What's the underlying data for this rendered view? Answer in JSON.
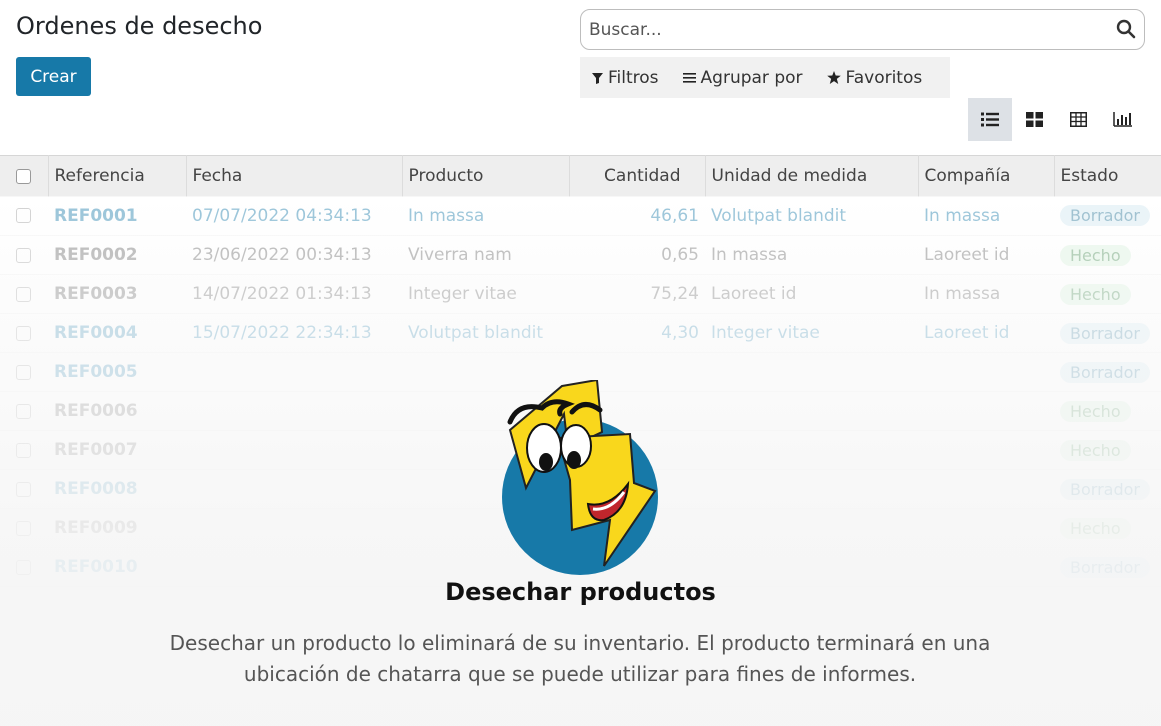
{
  "page": {
    "title": "Ordenes de desecho",
    "create_label": "Crear"
  },
  "search": {
    "placeholder": "Buscar...",
    "icon": "search-icon"
  },
  "filters": {
    "filters_label": "Filtros",
    "group_by_label": "Agrupar por",
    "favorites_label": "Favoritos"
  },
  "views": {
    "items": [
      "list-view-icon",
      "kanban-view-icon",
      "pivot-view-icon",
      "graph-view-icon"
    ],
    "active": "list-view-icon"
  },
  "table": {
    "headers": {
      "reference": "Referencia",
      "date": "Fecha",
      "product": "Producto",
      "quantity": "Cantidad",
      "uom": "Unidad de medida",
      "company": "Compañía",
      "state": "Estado"
    },
    "rows": [
      {
        "ref": "REF0001",
        "date": "07/07/2022 04:34:13",
        "product": "In massa",
        "qty": "46,61",
        "uom": "Volutpat blandit",
        "company": "In massa",
        "state": "Borrador",
        "state_kind": "draft",
        "link": true
      },
      {
        "ref": "REF0002",
        "date": "23/06/2022 00:34:13",
        "product": "Viverra nam",
        "qty": "0,65",
        "uom": "In massa",
        "company": "Laoreet id",
        "state": "Hecho",
        "state_kind": "done",
        "link": false
      },
      {
        "ref": "REF0003",
        "date": "14/07/2022 01:34:13",
        "product": "Integer vitae",
        "qty": "75,24",
        "uom": "Laoreet id",
        "company": "In massa",
        "state": "Hecho",
        "state_kind": "done",
        "link": false
      },
      {
        "ref": "REF0004",
        "date": "15/07/2022 22:34:13",
        "product": "Volutpat blandit",
        "qty": "4,30",
        "uom": "Integer vitae",
        "company": "Laoreet id",
        "state": "Borrador",
        "state_kind": "draft",
        "link": true
      },
      {
        "ref": "REF0005",
        "date": "",
        "product": "",
        "qty": "",
        "uom": "",
        "company": "",
        "state": "Borrador",
        "state_kind": "draft",
        "link": true
      },
      {
        "ref": "REF0006",
        "date": "",
        "product": "",
        "qty": "",
        "uom": "",
        "company": "",
        "state": "Hecho",
        "state_kind": "done",
        "link": false
      },
      {
        "ref": "REF0007",
        "date": "",
        "product": "",
        "qty": "",
        "uom": "",
        "company": "",
        "state": "Hecho",
        "state_kind": "done",
        "link": false
      },
      {
        "ref": "REF0008",
        "date": "",
        "product": "",
        "qty": "",
        "uom": "",
        "company": "",
        "state": "Borrador",
        "state_kind": "draft",
        "link": true
      },
      {
        "ref": "REF0009",
        "date": "",
        "product": "",
        "qty": "",
        "uom": "",
        "company": "",
        "state": "Hecho",
        "state_kind": "done",
        "link": false
      },
      {
        "ref": "REF0010",
        "date": "",
        "product": "",
        "qty": "",
        "uom": "",
        "company": "",
        "state": "Borrador",
        "state_kind": "draft",
        "link": true
      }
    ]
  },
  "helper": {
    "title": "Desechar productos",
    "text": "Desechar un producto lo eliminará de su inventario. El producto terminará en una ubicación de chatarra que se puede utilizar para fines de informes."
  },
  "colors": {
    "primary": "#1779a8",
    "draft_badge": "#cfe6f0",
    "done_badge": "#d4efd9",
    "mascot_yellow": "#f9d71c",
    "mascot_blue": "#1779a8"
  }
}
